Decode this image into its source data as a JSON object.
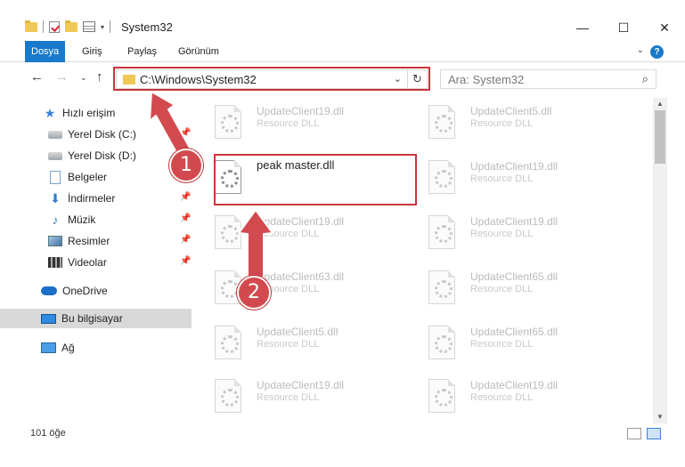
{
  "window": {
    "title": "System32",
    "minimize": "—",
    "maximize": "☐",
    "close": "✕"
  },
  "ribbon": {
    "tabs": [
      "Dosya",
      "Giriş",
      "Paylaş",
      "Görünüm"
    ],
    "help": "?"
  },
  "address": {
    "path": "C:\\Windows\\System32",
    "search_placeholder": "Ara: System32"
  },
  "sidebar": {
    "items": [
      {
        "label": "Hızlı erişim",
        "icon": "star-icon"
      },
      {
        "label": "Yerel Disk (C:)",
        "icon": "disk-icon"
      },
      {
        "label": "Yerel Disk (D:)",
        "icon": "disk-icon"
      },
      {
        "label": "Belgeler",
        "icon": "documents-icon"
      },
      {
        "label": "İndirmeler",
        "icon": "download-icon"
      },
      {
        "label": "Müzik",
        "icon": "music-icon"
      },
      {
        "label": "Resimler",
        "icon": "pictures-icon"
      },
      {
        "label": "Videolar",
        "icon": "videos-icon"
      },
      {
        "label": "OneDrive",
        "icon": "cloud-icon"
      },
      {
        "label": "Bu bilgisayar",
        "icon": "computer-icon"
      },
      {
        "label": "Ağ",
        "icon": "network-icon"
      }
    ]
  },
  "files": [
    {
      "name": "UpdateClient19.dll",
      "type": "Resource DLL"
    },
    {
      "name": "UpdateClient5.dll",
      "type": "Resource DLL"
    },
    {
      "name": "peak master.dll",
      "type": ""
    },
    {
      "name": "UpdateClient19.dll",
      "type": "Resource DLL"
    },
    {
      "name": "UpdateClient19.dll",
      "type": "Resource DLL"
    },
    {
      "name": "UpdateClient19.dll",
      "type": "Resource DLL"
    },
    {
      "name": "UpdateClient63.dll",
      "type": "Resource DLL"
    },
    {
      "name": "UpdateClient65.dll",
      "type": "Resource DLL"
    },
    {
      "name": "UpdateClient5.dll",
      "type": "Resource DLL"
    },
    {
      "name": "UpdateClient65.dll",
      "type": "Resource DLL"
    },
    {
      "name": "UpdateClient19.dll",
      "type": "Resource DLL"
    },
    {
      "name": "UpdateClient19.dll",
      "type": "Resource DLL"
    }
  ],
  "status": {
    "count": "101 öğe"
  },
  "annotations": {
    "step1": "1",
    "step2": "2",
    "color": "#d24a4f"
  }
}
